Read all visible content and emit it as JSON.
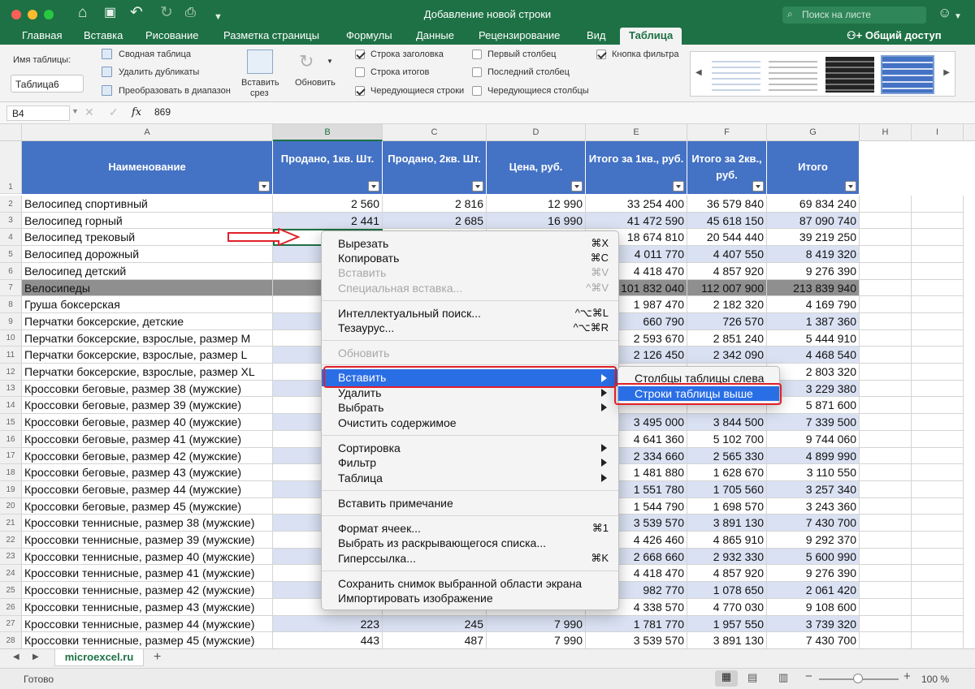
{
  "window": {
    "title": "Добавление новой строки",
    "search_placeholder": "Поиск на листе"
  },
  "tabs": [
    "Главная",
    "Вставка",
    "Рисование",
    "Разметка страницы",
    "Формулы",
    "Данные",
    "Рецензирование",
    "Вид",
    "Таблица"
  ],
  "share_label": "Общий доступ",
  "ribbon": {
    "table_name_label": "Имя таблицы:",
    "table_name_value": "Таблица6",
    "pivot": "Сводная таблица",
    "remove_dup": "Удалить дубликаты",
    "convert": "Преобразовать в диапазон",
    "insert_slicer_1": "Вставить",
    "insert_slicer_2": "срез",
    "refresh": "Обновить",
    "options": {
      "header_row": "Строка заголовка",
      "total_row": "Строка итогов",
      "banded_rows": "Чередующиеся строки",
      "first_col": "Первый столбец",
      "last_col": "Последний столбец",
      "banded_cols": "Чередующиеся столбцы",
      "filter_button": "Кнопка фильтра"
    }
  },
  "formula_bar": {
    "cell_ref": "B4",
    "value": "869",
    "fx": "fx"
  },
  "columns": [
    "A",
    "B",
    "C",
    "D",
    "E",
    "F",
    "G",
    "H",
    "I"
  ],
  "table_headers": [
    "Наименование",
    "Продано, 1кв. Шт.",
    "Продано, 2кв. Шт.",
    "Цена, руб.",
    "Итого за 1кв., руб.",
    "Итого за 2кв., руб.",
    "Итого"
  ],
  "rows": [
    {
      "n": "1"
    },
    {
      "n": "2",
      "a": "Велосипед спортивный",
      "b": "2 560",
      "c": "2 816",
      "d": "12 990",
      "e": "33 254 400",
      "f": "36 579 840",
      "g": "69 834 240"
    },
    {
      "n": "3",
      "a": "Велосипед горный",
      "b": "2 441",
      "c": "2 685",
      "d": "16 990",
      "e": "41 472 590",
      "f": "45 618 150",
      "g": "87 090 740"
    },
    {
      "n": "4",
      "a": "Велосипед трековый",
      "b": "",
      "c": "",
      "d": "",
      "e": "18 674 810",
      "f": "20 544 440",
      "g": "39 219 250"
    },
    {
      "n": "5",
      "a": "Велосипед дорожный",
      "b": "",
      "c": "",
      "d": "",
      "e": "4 011 770",
      "f": "4 407 550",
      "g": "8 419 320"
    },
    {
      "n": "6",
      "a": "Велосипед детский",
      "b": "",
      "c": "",
      "d": "",
      "e": "4 418 470",
      "f": "4 857 920",
      "g": "9 276 390"
    },
    {
      "n": "7",
      "a": "Велосипеды",
      "b": "",
      "c": "",
      "d": "",
      "e": "101 832 040",
      "f": "112 007 900",
      "g": "213 839 940",
      "grey": true
    },
    {
      "n": "8",
      "a": "Груша боксерская",
      "b": "",
      "c": "",
      "d": "",
      "e": "1 987 470",
      "f": "2 182 320",
      "g": "4 169 790"
    },
    {
      "n": "9",
      "a": "Перчатки боксерские, детские",
      "b": "",
      "c": "",
      "d": "",
      "e": "660 790",
      "f": "726 570",
      "g": "1 387 360"
    },
    {
      "n": "10",
      "a": "Перчатки боксерские, взрослые, размер M",
      "b": "",
      "c": "",
      "d": "",
      "e": "2 593 670",
      "f": "2 851 240",
      "g": "5 444 910"
    },
    {
      "n": "11",
      "a": "Перчатки боксерские, взрослые, размер L",
      "b": "",
      "c": "",
      "d": "",
      "e": "2 126 450",
      "f": "2 342 090",
      "g": "4 468 540"
    },
    {
      "n": "12",
      "a": "Перчатки боксерские, взрослые, размер XL",
      "b": "",
      "c": "",
      "d": "",
      "e": "",
      "f": "",
      "g": "2 803 320"
    },
    {
      "n": "13",
      "a": "Кроссовки беговые, размер 38 (мужские)",
      "b": "",
      "c": "",
      "d": "",
      "e": "",
      "f": "",
      "g": "3 229 380"
    },
    {
      "n": "14",
      "a": "Кроссовки беговые, размер 39 (мужские)",
      "b": "",
      "c": "",
      "d": "",
      "e": "",
      "f": "",
      "g": "5 871 600"
    },
    {
      "n": "15",
      "a": "Кроссовки беговые, размер 40 (мужские)",
      "b": "",
      "c": "",
      "d": "",
      "e": "3 495 000",
      "f": "3 844 500",
      "g": "7 339 500"
    },
    {
      "n": "16",
      "a": "Кроссовки беговые, размер 41 (мужские)",
      "b": "",
      "c": "",
      "d": "",
      "e": "4 641 360",
      "f": "5 102 700",
      "g": "9 744 060"
    },
    {
      "n": "17",
      "a": "Кроссовки беговые, размер 42 (мужские)",
      "b": "",
      "c": "",
      "d": "",
      "e": "2 334 660",
      "f": "2 565 330",
      "g": "4 899 990"
    },
    {
      "n": "18",
      "a": "Кроссовки беговые, размер 43 (мужские)",
      "b": "",
      "c": "",
      "d": "",
      "e": "1 481 880",
      "f": "1 628 670",
      "g": "3 110 550"
    },
    {
      "n": "19",
      "a": "Кроссовки беговые, размер 44 (мужские)",
      "b": "",
      "c": "",
      "d": "",
      "e": "1 551 780",
      "f": "1 705 560",
      "g": "3 257 340"
    },
    {
      "n": "20",
      "a": "Кроссовки беговые, размер 45 (мужские)",
      "b": "",
      "c": "",
      "d": "",
      "e": "1 544 790",
      "f": "1 698 570",
      "g": "3 243 360"
    },
    {
      "n": "21",
      "a": "Кроссовки теннисные, размер 38 (мужские)",
      "b": "",
      "c": "",
      "d": "",
      "e": "3 539 570",
      "f": "3 891 130",
      "g": "7 430 700"
    },
    {
      "n": "22",
      "a": "Кроссовки теннисные, размер 39 (мужские)",
      "b": "",
      "c": "",
      "d": "",
      "e": "4 426 460",
      "f": "4 865 910",
      "g": "9 292 370"
    },
    {
      "n": "23",
      "a": "Кроссовки теннисные, размер 40 (мужские)",
      "b": "",
      "c": "",
      "d": "",
      "e": "2 668 660",
      "f": "2 932 330",
      "g": "5 600 990"
    },
    {
      "n": "24",
      "a": "Кроссовки теннисные, размер 41 (мужские)",
      "b": "",
      "c": "",
      "d": "",
      "e": "4 418 470",
      "f": "4 857 920",
      "g": "9 276 390"
    },
    {
      "n": "25",
      "a": "Кроссовки теннисные, размер 42 (мужские)",
      "b": "",
      "c": "",
      "d": "",
      "e": "982 770",
      "f": "1 078 650",
      "g": "2 061 420"
    },
    {
      "n": "26",
      "a": "Кроссовки теннисные, размер 43 (мужские)",
      "b": "",
      "c": "",
      "d": "",
      "e": "4 338 570",
      "f": "4 770 030",
      "g": "9 108 600"
    },
    {
      "n": "27",
      "a": "Кроссовки теннисные, размер 44 (мужские)",
      "b": "223",
      "c": "245",
      "d": "7 990",
      "e": "1 781 770",
      "f": "1 957 550",
      "g": "3 739 320"
    },
    {
      "n": "28",
      "a": "Кроссовки теннисные, размер 45 (мужские)",
      "b": "443",
      "c": "487",
      "d": "7 990",
      "e": "3 539 570",
      "f": "3 891 130",
      "g": "7 430 700"
    }
  ],
  "context_menu": {
    "cut": "Вырезать",
    "cut_sc": "⌘X",
    "copy": "Копировать",
    "copy_sc": "⌘C",
    "paste": "Вставить",
    "paste_sc": "⌘V",
    "paste_special": "Специальная вставка...",
    "paste_special_sc": "^⌘V",
    "smart_lookup": "Интеллектуальный поиск...",
    "smart_lookup_sc": "^⌥⌘L",
    "thesaurus": "Тезаурус...",
    "thesaurus_sc": "^⌥⌘R",
    "refresh": "Обновить",
    "insert": "Вставить",
    "delete": "Удалить",
    "select": "Выбрать",
    "clear": "Очистить содержимое",
    "sort": "Сортировка",
    "filter": "Фильтр",
    "table": "Таблица",
    "insert_comment": "Вставить примечание",
    "format_cells": "Формат ячеек...",
    "format_cells_sc": "⌘1",
    "pick_list": "Выбрать из раскрывающегося списка...",
    "hyperlink": "Гиперссылка...",
    "hyperlink_sc": "⌘K",
    "screenshot": "Сохранить снимок выбранной области экрана",
    "import_image": "Импортировать изображение"
  },
  "submenu": {
    "cols_left": "Столбцы таблицы слева",
    "rows_above": "Строки таблицы выше"
  },
  "sheet_tab": "microexcel.ru",
  "status": "Готово",
  "zoom": "100 %",
  "colors": {
    "excel_green": "#1e7145",
    "table_blue": "#4472c4",
    "band_blue": "#d9e1f2",
    "highlight": "#2a6ee6",
    "red_outline": "#e0202a"
  }
}
